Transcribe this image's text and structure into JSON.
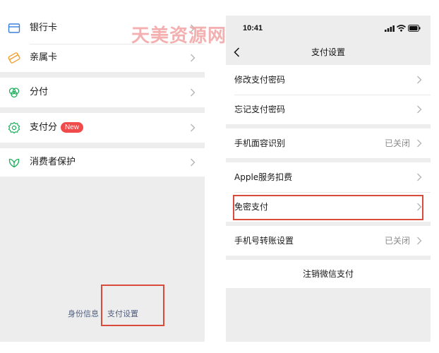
{
  "watermark": "天美资源网",
  "left_panel": {
    "items": [
      {
        "label": "银行卡",
        "icon": "bank-card-icon"
      },
      {
        "label": "亲属卡",
        "icon": "family-card-icon"
      },
      {
        "label": "分付",
        "icon": "fenfu-icon"
      },
      {
        "label": "支付分",
        "icon": "payment-score-icon",
        "badge": "New"
      },
      {
        "label": "消费者保护",
        "icon": "consumer-protection-icon"
      }
    ],
    "footer_links": {
      "identity": "身份信息",
      "payment_settings": "支付设置"
    },
    "colors": {
      "icon_green": "#1aad5a",
      "icon_orange": "#f0a030",
      "icon_blue": "#3b80d8",
      "badge_red": "#f04a4a",
      "highlight_red": "#d94b3b"
    }
  },
  "right_panel": {
    "status_bar": {
      "time": "10:41"
    },
    "nav": {
      "title": "支付设置",
      "back_icon": "back-chevron-icon"
    },
    "items": [
      {
        "label": "修改支付密码",
        "value": ""
      },
      {
        "label": "忘记支付密码",
        "value": ""
      },
      {
        "label": "手机面容识别",
        "value": "已关闭"
      },
      {
        "label": "Apple服务扣费",
        "value": ""
      },
      {
        "label": "免密支付",
        "value": ""
      },
      {
        "label": "手机号转账设置",
        "value": "已关闭"
      }
    ],
    "deregister": "注销微信支付"
  }
}
